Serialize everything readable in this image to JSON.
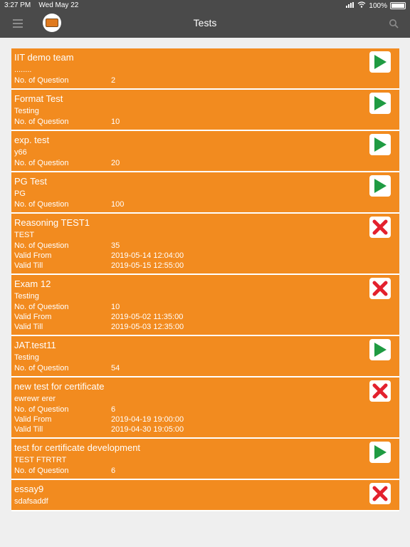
{
  "statusbar": {
    "time": "3:27 PM",
    "date": "Wed May 22",
    "battery": "100%"
  },
  "header": {
    "title": "Tests"
  },
  "labels": {
    "questions": "No. of Question",
    "valid_from": "Valid From",
    "valid_till": "Valid Till"
  },
  "colors": {
    "card": "#f28b1f",
    "play": "#1f9b42",
    "close": "#e3212e",
    "nav": "#4a4a4a"
  },
  "tests": [
    {
      "title": "IIT demo team",
      "subtitle": "........",
      "questions": "2",
      "valid_from": "",
      "valid_till": "",
      "status": "play"
    },
    {
      "title": "Format Test",
      "subtitle": "Testing",
      "questions": "10",
      "valid_from": "",
      "valid_till": "",
      "status": "play"
    },
    {
      "title": "exp. test",
      "subtitle": "y66",
      "questions": "20",
      "valid_from": "",
      "valid_till": "",
      "status": "play"
    },
    {
      "title": "PG Test",
      "subtitle": "PG",
      "questions": "100",
      "valid_from": "",
      "valid_till": "",
      "status": "play"
    },
    {
      "title": "Reasoning TEST1",
      "subtitle": "TEST",
      "questions": "35",
      "valid_from": "2019-05-14 12:04:00",
      "valid_till": "2019-05-15 12:55:00",
      "status": "closed"
    },
    {
      "title": "Exam 12",
      "subtitle": "Testing",
      "questions": "10",
      "valid_from": "2019-05-02 11:35:00",
      "valid_till": "2019-05-03 12:35:00",
      "status": "closed"
    },
    {
      "title": "JAT.test11",
      "subtitle": "Testing",
      "questions": "54",
      "valid_from": "",
      "valid_till": "",
      "status": "play"
    },
    {
      "title": "new test for certificate",
      "subtitle": "ewrewr erer",
      "questions": "6",
      "valid_from": "2019-04-19 19:00:00",
      "valid_till": "2019-04-30 19:05:00",
      "status": "closed"
    },
    {
      "title": "test for certificate development",
      "subtitle": "TEST FTRTRT",
      "questions": "6",
      "valid_from": "",
      "valid_till": "",
      "status": "play"
    },
    {
      "title": "essay9",
      "subtitle": "sdafsaddf",
      "questions": "",
      "valid_from": "",
      "valid_till": "",
      "status": "closed"
    }
  ]
}
